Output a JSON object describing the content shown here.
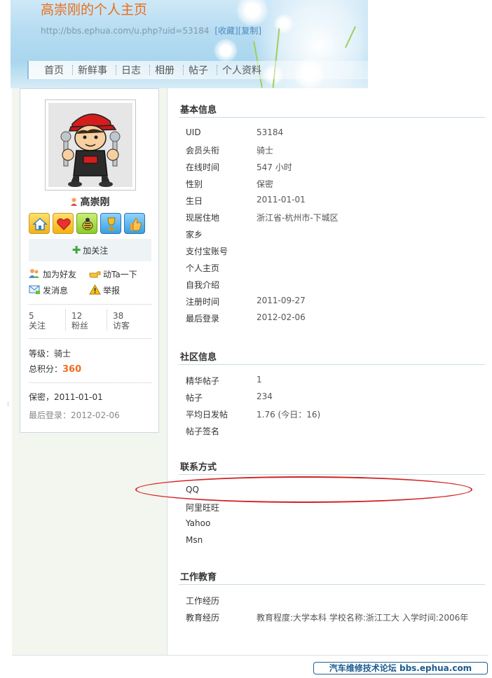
{
  "header": {
    "title": "高崇刚的个人主页",
    "url": "http://bbs.ephua.com/u.php?uid=53184",
    "favorite_label": "[收藏]",
    "copy_label": "[复制]"
  },
  "nav": {
    "items": [
      "首页",
      "新鲜事",
      "日志",
      "相册",
      "帖子",
      "个人资料"
    ]
  },
  "profile": {
    "name": "高崇刚",
    "follow_label": "加关注",
    "actions": {
      "add_friend": "加为好友",
      "poke": "动Ta一下",
      "message": "发消息",
      "report": "举报"
    },
    "stats": [
      {
        "value": "5",
        "label": "关注"
      },
      {
        "value": "12",
        "label": "粉丝"
      },
      {
        "value": "38",
        "label": "访客"
      }
    ],
    "level_text": "等级：骑士",
    "score_label": "总积分：",
    "score_value": "360",
    "birthday_text": "保密，2011-01-01",
    "last_login_text": "最后登录：2012-02-06"
  },
  "sections": {
    "basic": {
      "title": "基本信息",
      "rows": [
        {
          "label": "UID",
          "value": "53184"
        },
        {
          "label": "会员头衔",
          "value": "骑士"
        },
        {
          "label": "在线时间",
          "value": "547 小时"
        },
        {
          "label": "性别",
          "value": "保密"
        },
        {
          "label": "生日",
          "value": "2011-01-01"
        },
        {
          "label": "现居住地",
          "value": "浙江省-杭州市-下城区"
        },
        {
          "label": "家乡",
          "value": ""
        },
        {
          "label": "支付宝账号",
          "value": ""
        },
        {
          "label": "个人主页",
          "value": ""
        },
        {
          "label": "自我介绍",
          "value": ""
        },
        {
          "label": "注册时间",
          "value": "2011-09-27"
        },
        {
          "label": "最后登录",
          "value": "2012-02-06"
        }
      ]
    },
    "community": {
      "title": "社区信息",
      "rows": [
        {
          "label": "精华帖子",
          "value": "1"
        },
        {
          "label": "帖子",
          "value": "234"
        },
        {
          "label": "平均日发帖",
          "value": "1.76 (今日：16)"
        },
        {
          "label": "帖子签名",
          "value": ""
        }
      ]
    },
    "contact": {
      "title": "联系方式",
      "rows": [
        {
          "label": "QQ",
          "value": ""
        },
        {
          "label": "阿里旺旺",
          "value": ""
        },
        {
          "label": "Yahoo",
          "value": ""
        },
        {
          "label": "Msn",
          "value": ""
        }
      ]
    },
    "work": {
      "title": "工作教育",
      "rows": [
        {
          "label": "工作经历",
          "value": ""
        },
        {
          "label": "教育经历",
          "value": "教育程度:大学本科 学校名称:浙江工大 入学时间:2006年"
        }
      ]
    }
  },
  "watermark": "汽车维修技术论坛 bbs.ephua.com",
  "colors": {
    "title_orange": "#e86e1a",
    "score_orange": "#f26c22",
    "annotation_red": "#d32121",
    "link_blue": "#4e8bbf"
  }
}
